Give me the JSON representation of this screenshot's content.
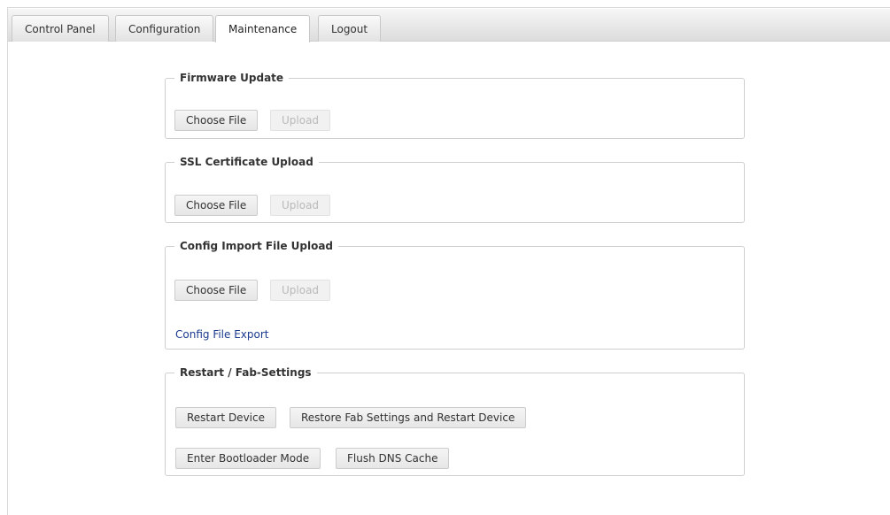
{
  "tabs": [
    {
      "label": "Control Panel"
    },
    {
      "label": "Configuration"
    },
    {
      "label": "Maintenance"
    },
    {
      "label": "Logout"
    }
  ],
  "active_tab": "Maintenance",
  "sections": {
    "firmware": {
      "title": "Firmware Update",
      "choose_label": "Choose File",
      "upload_label": "Upload"
    },
    "ssl": {
      "title": "SSL Certificate Upload",
      "choose_label": "Choose File",
      "upload_label": "Upload"
    },
    "config_import": {
      "title": "Config Import File Upload",
      "choose_label": "Choose File",
      "upload_label": "Upload",
      "export_link": "Config File Export"
    },
    "restart": {
      "title": "Restart / Fab-Settings",
      "restart_label": "Restart Device",
      "restore_label": "Restore Fab Settings and Restart Device",
      "bootloader_label": "Enter Bootloader Mode",
      "flush_dns_label": "Flush DNS Cache"
    }
  }
}
